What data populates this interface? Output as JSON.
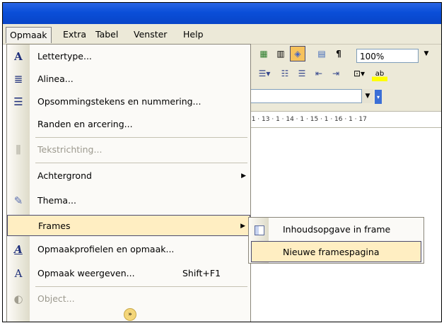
{
  "menubar": {
    "items": [
      "Opmaak",
      "Extra",
      "Tabel",
      "Venster",
      "Help"
    ]
  },
  "toolbar": {
    "zoom_value": "100%"
  },
  "ruler": {
    "text": "· 1 · 13 · 1 · 14 · 1 · 15 · 1 · 16 · 1 · 17"
  },
  "menu": {
    "items": [
      {
        "label": "Lettertype...",
        "icon": "font-icon"
      },
      {
        "label": "Alinea...",
        "icon": "paragraph-icon"
      },
      {
        "label": "Opsommingstekens en nummering...",
        "icon": "bullets-icon"
      },
      {
        "label": "Randen en arcering...",
        "icon": ""
      },
      {
        "label": "Tekstrichting...",
        "icon": "text-direction-icon",
        "disabled": true
      },
      {
        "label": "Achtergrond",
        "icon": "",
        "submenu": true
      },
      {
        "label": "Thema...",
        "icon": "theme-icon"
      },
      {
        "label": "Frames",
        "icon": "",
        "submenu": true,
        "highlighted": true
      },
      {
        "label": "Opmaakprofielen en opmaak...",
        "icon": "styles-icon"
      },
      {
        "label": "Opmaak weergeven...",
        "icon": "reveal-formatting-icon",
        "shortcut": "Shift+F1"
      },
      {
        "label": "Object...",
        "icon": "object-icon",
        "disabled": true
      }
    ]
  },
  "submenu": {
    "items": [
      {
        "label": "Inhoudsopgave in frame",
        "icon": "toc-frame-icon"
      },
      {
        "label": "Nieuwe framespagina",
        "highlighted": true
      }
    ]
  },
  "colors": {
    "titlebar": "#0a4ed8",
    "menu_highlight": "#ffeec2",
    "menubar": "#ece9d8"
  }
}
